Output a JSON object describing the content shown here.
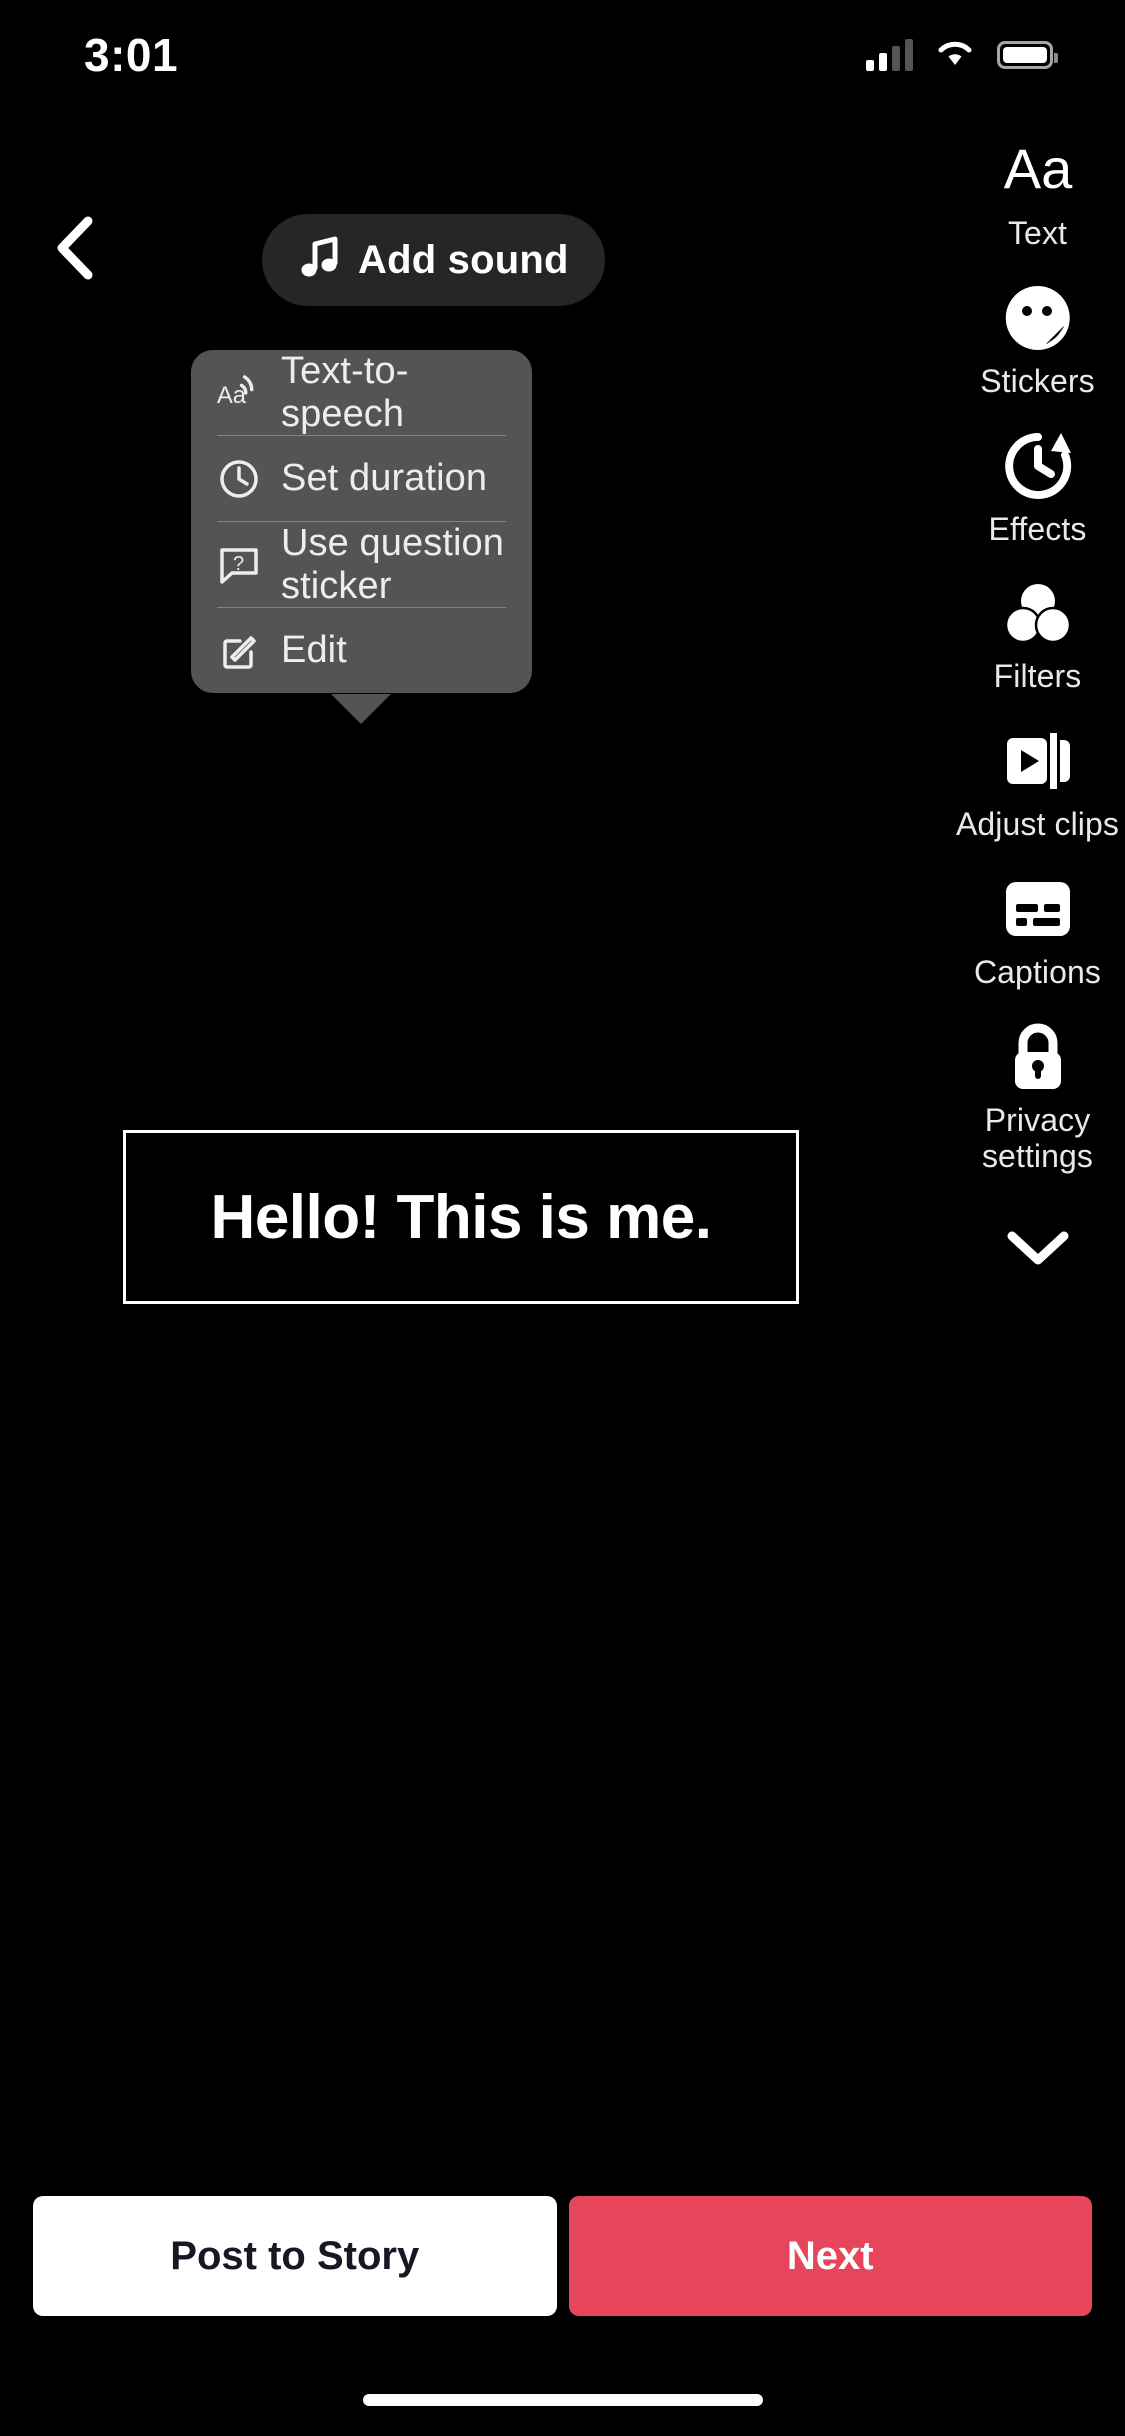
{
  "status_bar": {
    "time": "3:01",
    "signal_icon": "cellular-signal-icon",
    "wifi_icon": "wifi-icon",
    "battery_icon": "battery-icon"
  },
  "header": {
    "back_icon": "chevron-left-icon",
    "add_sound": {
      "label": "Add sound",
      "icon": "music-note-icon"
    }
  },
  "context_menu": {
    "items": [
      {
        "label": "Text-to-speech",
        "icon": "text-to-speech-icon"
      },
      {
        "label": "Set duration",
        "icon": "clock-icon"
      },
      {
        "label": "Use question sticker",
        "icon": "question-bubble-icon"
      },
      {
        "label": "Edit",
        "icon": "pencil-square-icon"
      }
    ],
    "background_color": "#545454"
  },
  "text_overlay": {
    "text": "Hello! This is me.",
    "border_color": "#ffffff"
  },
  "toolbar": {
    "items": [
      {
        "label": "Text",
        "icon": "text-aa-icon"
      },
      {
        "label": "Stickers",
        "icon": "sticker-smiley-icon"
      },
      {
        "label": "Effects",
        "icon": "effects-clock-icon"
      },
      {
        "label": "Filters",
        "icon": "filters-circles-icon"
      },
      {
        "label": "Adjust clips",
        "icon": "adjust-clips-icon"
      },
      {
        "label": "Captions",
        "icon": "captions-icon"
      },
      {
        "label": "Privacy settings",
        "icon": "lock-icon"
      }
    ],
    "collapse_icon": "chevron-down-icon"
  },
  "bottom_bar": {
    "post_to_story": {
      "label": "Post to Story",
      "color": "#ffffff"
    },
    "next": {
      "label": "Next",
      "color": "#e7455b"
    }
  }
}
